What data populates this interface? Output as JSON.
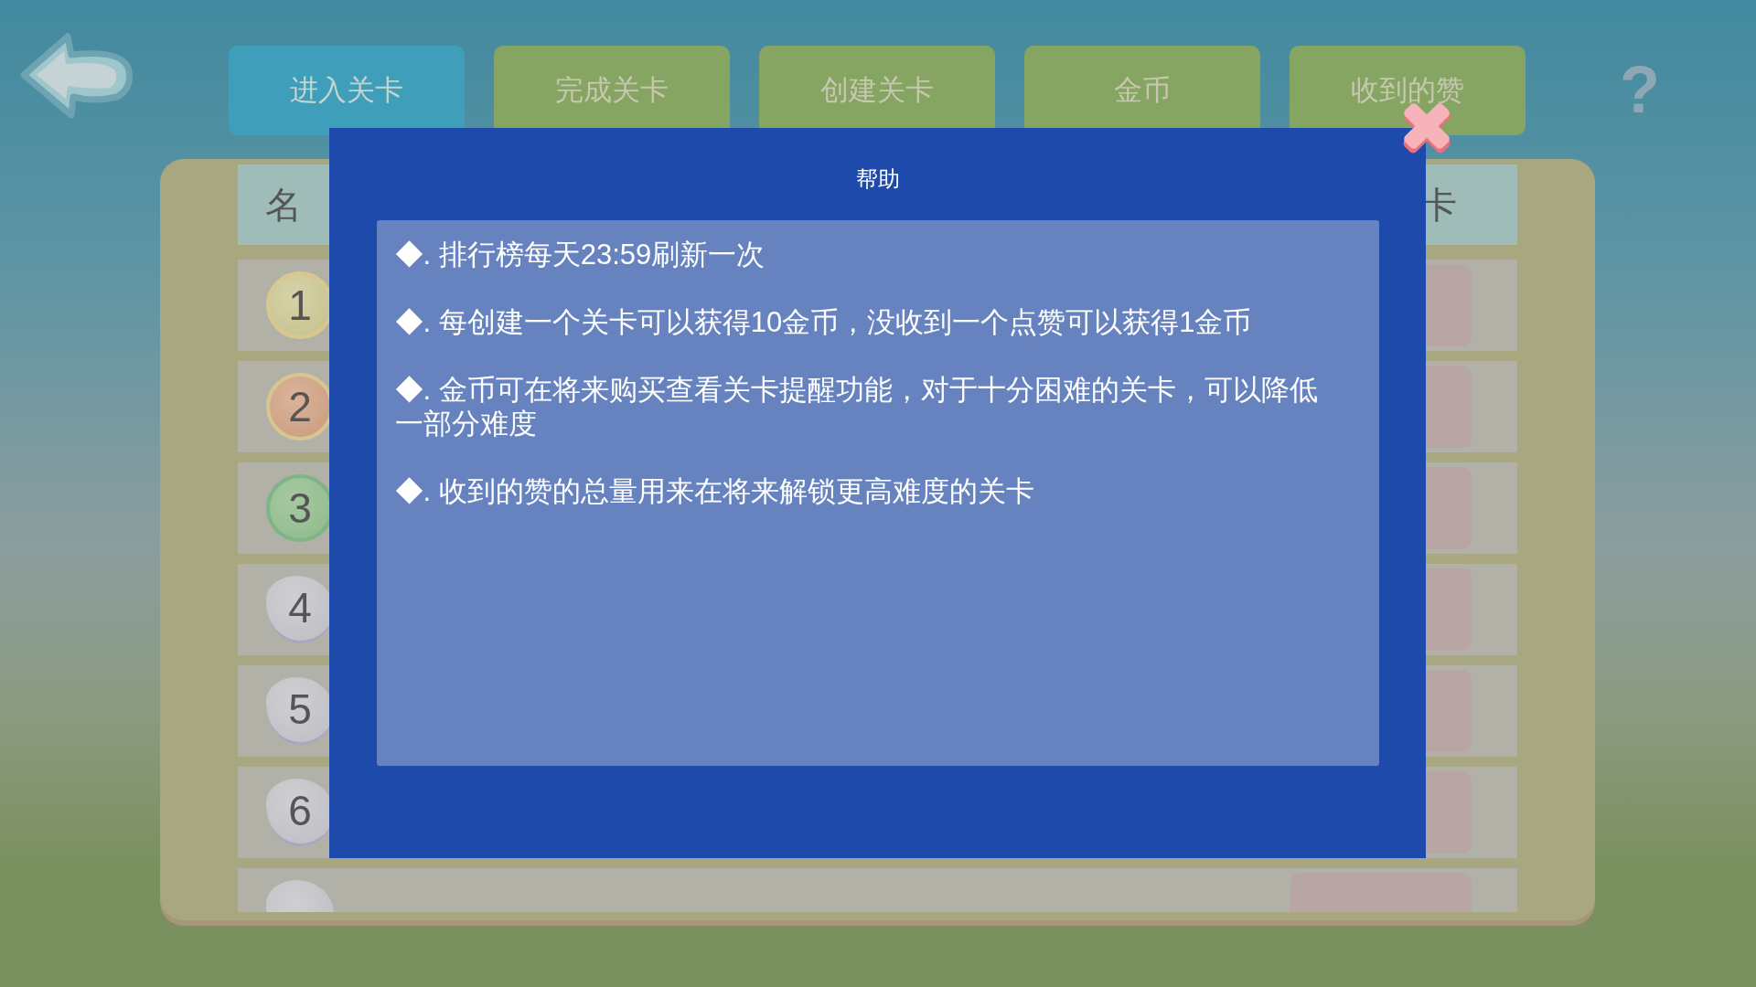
{
  "tabs": [
    {
      "label": "进入关卡",
      "selected": true
    },
    {
      "label": "完成关卡",
      "selected": false
    },
    {
      "label": "创建关卡",
      "selected": false
    },
    {
      "label": "金币",
      "selected": false
    },
    {
      "label": "收到的赞",
      "selected": false
    }
  ],
  "help_button": {
    "label": "?"
  },
  "ranking": {
    "columns": [
      {
        "label": "名"
      },
      {
        "label": "卡"
      }
    ],
    "rows": [
      {
        "rank": "1",
        "kind": "gold"
      },
      {
        "rank": "2",
        "kind": "bronze"
      },
      {
        "rank": "3",
        "kind": "green"
      },
      {
        "rank": "4",
        "kind": "silver"
      },
      {
        "rank": "5",
        "kind": "silver"
      },
      {
        "rank": "6",
        "kind": "silver"
      },
      {
        "kind": "silver"
      }
    ]
  },
  "dialog": {
    "title": "帮助",
    "items": [
      "◆. 排行榜每天23:59刷新一次",
      "◆. 每创建一个关卡可以获得10金币，没收到一个点赞可以获得1金币",
      "◆. 金币可在将来购买查看关卡提醒功能，对于十分困难的关卡，可以降低一部分难度",
      "◆. 收到的赞的总量用来在将来解锁更高难度的关卡"
    ]
  }
}
